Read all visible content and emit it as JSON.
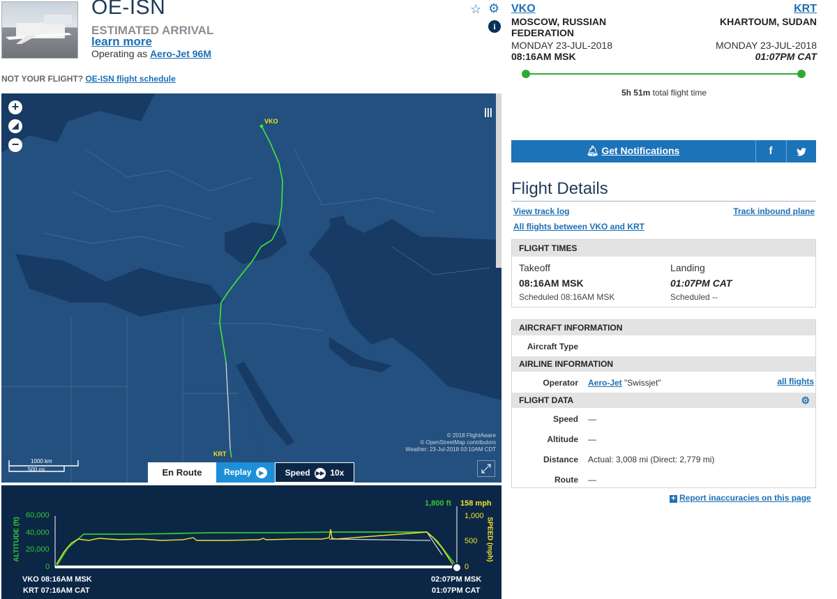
{
  "flight": {
    "ident": "OE-ISN",
    "status": "ESTIMATED ARRIVAL",
    "learn_more": "learn more",
    "operating_prefix": "Operating as",
    "operating_as": "Aero-Jet 96M",
    "not_your_flight": "NOT YOUR FLIGHT?",
    "schedule_link": "OE-ISN flight schedule"
  },
  "route": {
    "origin": {
      "code": "VKO",
      "city": "MOSCOW, RUSSIAN FEDERATION",
      "date": "MONDAY 23-JUL-2018",
      "time": "08:16AM MSK"
    },
    "destination": {
      "code": "KRT",
      "city": "KHARTOUM, SUDAN",
      "date": "MONDAY 23-JUL-2018",
      "time": "01:07PM CAT"
    },
    "total_time_value": "5h 51m",
    "total_time_label": "total flight time",
    "progress": 1.0
  },
  "actions": {
    "notifications": "Get Notifications",
    "facebook": "f",
    "twitter": "🐦"
  },
  "details": {
    "title": "Flight Details",
    "view_track_log": "View track log",
    "track_inbound": "Track inbound plane",
    "all_flights_between": "All flights between VKO and KRT"
  },
  "times": {
    "header": "FLIGHT TIMES",
    "takeoff_label": "Takeoff",
    "takeoff_time": "08:16AM MSK",
    "takeoff_sched": "Scheduled 08:16AM MSK",
    "landing_label": "Landing",
    "landing_time": "01:07PM CAT",
    "landing_sched": "Scheduled --"
  },
  "aircraft": {
    "header": "AIRCRAFT INFORMATION",
    "type_label": "Aircraft Type",
    "type_value": ""
  },
  "airline": {
    "header": "AIRLINE INFORMATION",
    "operator_label": "Operator",
    "operator_link": "Aero-Jet",
    "operator_name": "\"Swissjet\"",
    "all_flights": "all flights"
  },
  "flight_data": {
    "header": "FLIGHT DATA",
    "speed_label": "Speed",
    "speed_value": "—",
    "altitude_label": "Altitude",
    "altitude_value": "—",
    "distance_label": "Distance",
    "distance_value": "Actual: 3,008 mi (Direct: 2,779 mi)",
    "route_label": "Route",
    "route_value": "—"
  },
  "report": "Report inaccuracies on this page",
  "map": {
    "labels": {
      "origin": "VKO",
      "destination": "KRT"
    },
    "attribution": [
      "© 2018 FlightAware",
      "© OpenStreetMap contributors",
      "Weather: 23-Jul-2018 03:10AM CDT"
    ],
    "scale_km": "1000 km",
    "scale_mi": "500 mi",
    "tabs": {
      "en_route": "En Route",
      "replay": "Replay",
      "speed": "Speed",
      "speed_value": "10x"
    }
  },
  "graph": {
    "current_alt": "1,800 ft",
    "current_speed": "158 mph",
    "alt_axis_label": "ALTITUDE (ft)",
    "speed_axis_label": "SPEED (mph)",
    "alt_ticks": [
      "60,000",
      "40,000",
      "20,000",
      "0"
    ],
    "speed_ticks": [
      "1,000",
      "500",
      "0"
    ],
    "start_msk": "VKO 08:16AM MSK",
    "start_cat": "KRT 07:16AM CAT",
    "end_msk": "02:07PM MSK",
    "end_cat": "01:07PM CAT",
    "colors": {
      "altitude": "#32c832",
      "speed": "#f3e22a"
    }
  }
}
